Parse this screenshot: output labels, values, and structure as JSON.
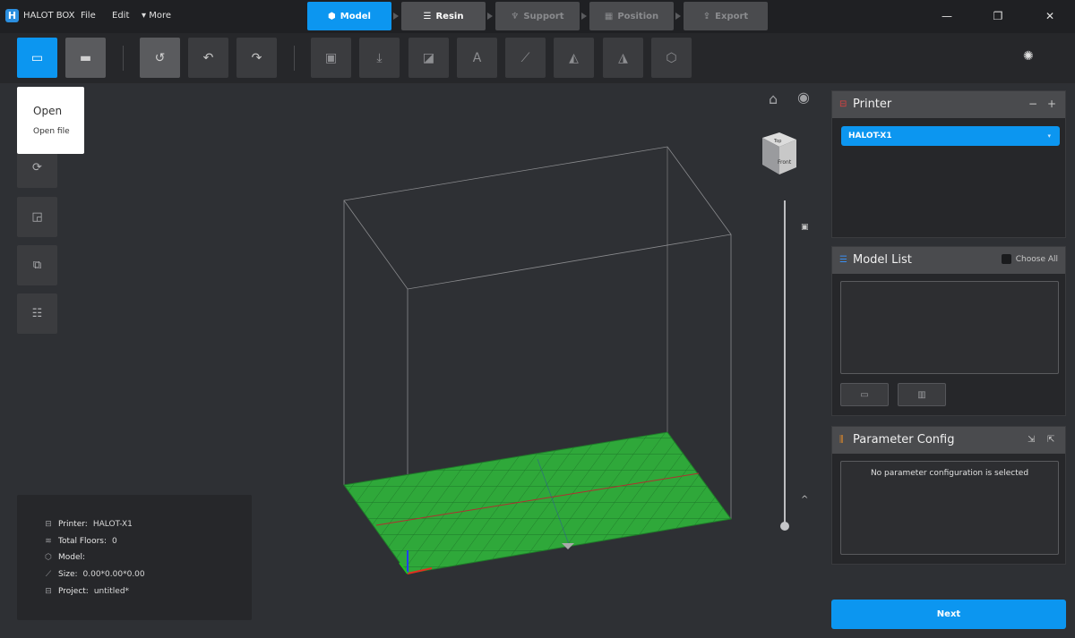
{
  "app": {
    "title": "HALOT BOX",
    "logo": "H"
  },
  "menu": {
    "file": "File",
    "edit": "Edit",
    "more": "More"
  },
  "steps": [
    {
      "label": "Model",
      "icon": "cube-icon"
    },
    {
      "label": "Resin",
      "icon": "sliders-icon"
    },
    {
      "label": "Support",
      "icon": "support-icon"
    },
    {
      "label": "Position",
      "icon": "grid-icon"
    },
    {
      "label": "Export",
      "icon": "export-icon"
    }
  ],
  "open_popup": {
    "title": "Open",
    "item": "Open file"
  },
  "view_cube": {
    "top": "Top",
    "front": "Front"
  },
  "info": {
    "printer_label": "Printer:",
    "printer_value": "HALOT-X1",
    "floors_label": "Total Floors:",
    "floors_value": "0",
    "model_label": "Model:",
    "model_value": "",
    "size_label": "Size:",
    "size_value": "0.00*0.00*0.00",
    "project_label": "Project:",
    "project_value": "untitled*"
  },
  "printer_panel": {
    "title": "Printer",
    "selected": "HALOT-X1"
  },
  "model_list_panel": {
    "title": "Model List",
    "choose_all": "Choose All"
  },
  "param_panel": {
    "title": "Parameter Config",
    "empty_message": "No parameter configuration is selected"
  },
  "next_label": "Next",
  "colors": {
    "accent": "#0c96f0",
    "platform": "#2fa83a",
    "background": "#2e3034"
  }
}
